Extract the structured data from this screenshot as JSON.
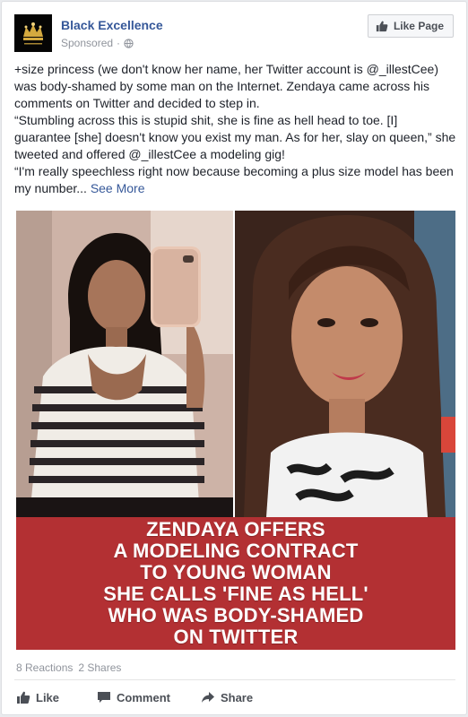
{
  "post": {
    "page_name": "Black Excellence",
    "sponsored_label": "Sponsored",
    "sponsored_separator": "·",
    "like_page_label": "Like Page",
    "text": {
      "p1": "+size princess (we don't know her name, her Twitter account is @_illestCee) was body-shamed by some man on the Internet. Zendaya came across his comments on Twitter and decided to step in.",
      "p2": "“Stumbling across this is stupid shit, she is fine as hell head to toe. [I] guarantee [she] doesn't know you exist my man. As for her, slay on queen,” she tweeted and offered @_illestCee a modeling gig!",
      "p3": "“I'm really speechless right now because becoming a plus size model has been my number...",
      "see_more": "See More"
    },
    "banner_lines": [
      "ZENDAYA OFFERS",
      "A MODELING CONTRACT",
      "TO YOUNG WOMAN",
      "SHE CALLS 'FINE AS HELL'",
      "WHO WAS BODY-SHAMED",
      "ON TWITTER"
    ],
    "reactions_label": "8 Reactions",
    "shares_label": "2 Shares",
    "actions": {
      "like": "Like",
      "comment": "Comment",
      "share": "Share"
    }
  },
  "colors": {
    "link_blue": "#365899",
    "banner_red": "#b33033",
    "muted_gray": "#90949c"
  },
  "icons": {
    "avatar": "crown-logo",
    "globe": "globe-icon",
    "like": "thumbs-up-icon",
    "comment": "comment-icon",
    "share": "share-arrow-icon"
  }
}
